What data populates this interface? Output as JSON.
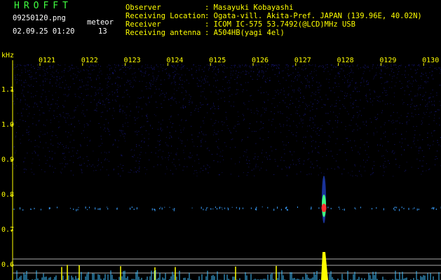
{
  "header": {
    "app_title": "HROFFT",
    "filename": "09250120.png",
    "datetime": "02.09.25 01:20",
    "meteor_label": "meteor",
    "meteor_count": "13",
    "fields": [
      {
        "label": "Observer",
        "value": ": Masayuki Kobayashi"
      },
      {
        "label": "Receiving Location",
        "value": ": Ogata-vill. Akita-Pref. JAPAN (139.96E, 40.02N)"
      },
      {
        "label": "Receiver",
        "value": ": ICOM IC-575 53.7492(@LCD)MHz USB"
      },
      {
        "label": "Receiving antenna",
        "value": ": A504HB(yagi 4el)"
      }
    ]
  },
  "spectrogram": {
    "unit": "kHz",
    "time_ticks": [
      "0121",
      "0122",
      "0123",
      "0124",
      "0125",
      "0126",
      "0127",
      "0128",
      "0129",
      "0130"
    ],
    "freq_ticks": [
      "1.1",
      "1.0",
      "0.9",
      "0.8",
      "0.7",
      "0.6"
    ],
    "colors": {
      "background": "#000000",
      "noise": "#1a1a8c",
      "carrier": "#3aa0ff",
      "meteor_head": "#ff3030",
      "meteor_mid": "#40ff80",
      "baseline": "#ffff00",
      "baseline_noise": "#40c0ff"
    }
  }
}
